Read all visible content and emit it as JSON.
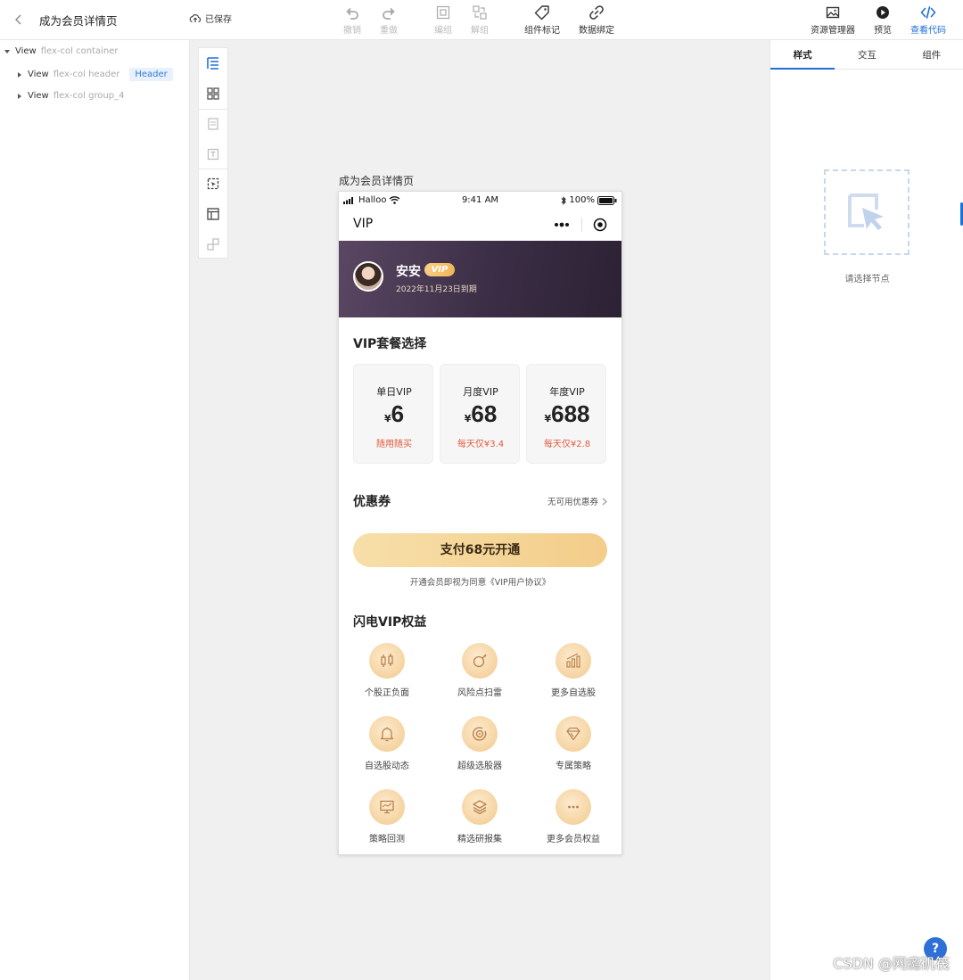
{
  "topbar": {
    "page_title": "成为会员详情页",
    "saved": "已保存",
    "undo": "撤销",
    "redo": "重做",
    "group": "编组",
    "ungroup": "解组",
    "component_tag": "组件标记",
    "data_binding": "数据绑定",
    "asset_manager": "资源管理器",
    "preview": "预览",
    "view_code": "查看代码"
  },
  "tree": {
    "rows": [
      {
        "type": "View",
        "cls": "flex-col container"
      },
      {
        "type": "View",
        "cls": "flex-col header",
        "tag": "Header"
      },
      {
        "type": "View",
        "cls": "flex-col group_4"
      }
    ]
  },
  "right_panel": {
    "tabs": [
      "样式",
      "交互",
      "组件"
    ],
    "empty_text": "请选择节点"
  },
  "canvas": {
    "label": "成为会员详情页"
  },
  "phone": {
    "status": {
      "carrier": "Halloo",
      "time": "9:41 AM",
      "battery": "100%"
    },
    "nav_title": "VIP",
    "user": {
      "name": "安安",
      "badge": "VIP",
      "expire": "2022年11月23日到期"
    },
    "plans_title": "VIP套餐选择",
    "plans": [
      {
        "name": "单日VIP",
        "currency": "¥",
        "price": "6",
        "note": "随用随买"
      },
      {
        "name": "月度VIP",
        "currency": "¥",
        "price": "68",
        "note": "每天仅¥3.4"
      },
      {
        "name": "年度VIP",
        "currency": "¥",
        "price": "688",
        "note": "每天仅¥2.8"
      }
    ],
    "coupon": {
      "label": "优惠券",
      "value": "无可用优惠券"
    },
    "pay_button": "支付68元开通",
    "agreement": "开通会员即视为同意《VIP用户协议》",
    "benefits_title": "闪电VIP权益",
    "benefits": [
      {
        "label": "个股正负面",
        "icon": "candlestick-icon"
      },
      {
        "label": "风险点扫雷",
        "icon": "bomb-icon"
      },
      {
        "label": "更多自选股",
        "icon": "bar-chart-icon"
      },
      {
        "label": "自选股动态",
        "icon": "bell-icon"
      },
      {
        "label": "超级选股器",
        "icon": "target-icon"
      },
      {
        "label": "专属策略",
        "icon": "diamond-icon"
      },
      {
        "label": "策略回测",
        "icon": "monitor-icon"
      },
      {
        "label": "精选研报集",
        "icon": "layers-icon"
      },
      {
        "label": "更多会员权益",
        "icon": "more-icon"
      }
    ]
  },
  "watermark": "CSDN @网瘾矶筏",
  "colors": {
    "accent": "#1f6fd8",
    "gold": "#f3cd8a",
    "banner": "#3b2d45",
    "price_note": "#e15a3c"
  }
}
